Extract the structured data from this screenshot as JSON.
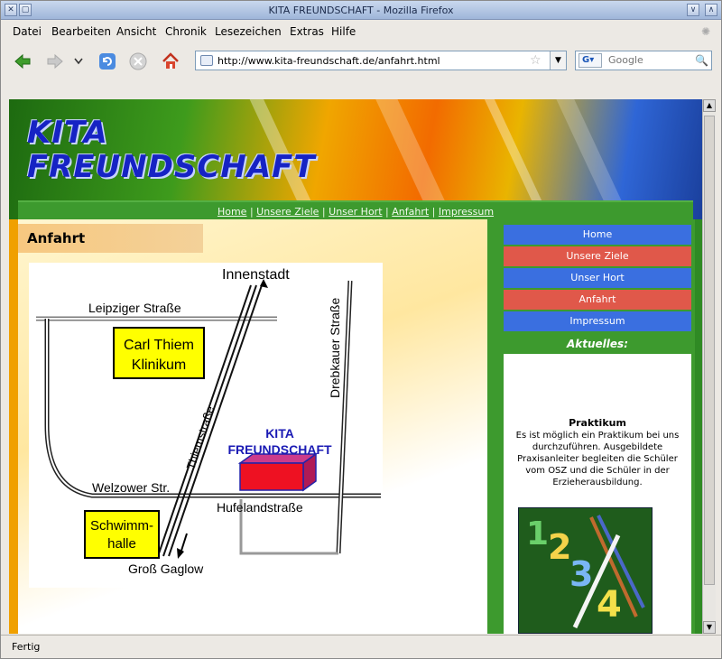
{
  "window": {
    "title": "KITA FREUNDSCHAFT - Mozilla Firefox"
  },
  "menubar": {
    "items": [
      "Datei",
      "Bearbeiten",
      "Ansicht",
      "Chronik",
      "Lesezeichen",
      "Extras",
      "Hilfe"
    ]
  },
  "toolbar": {
    "url": "http://www.kita-freundschaft.de/anfahrt.html",
    "search_placeholder": "Google"
  },
  "status": {
    "text": "Fertig"
  },
  "page": {
    "logo_line1": "KITA",
    "logo_line2": "FREUNDSCHAFT",
    "topnav": [
      "Home",
      "Unsere Ziele",
      "Unser Hort",
      "Anfahrt",
      "Impressum"
    ],
    "topnav_separator": "|",
    "heading": "Anfahrt",
    "sidebar_menu": [
      {
        "label": "Home",
        "color": "#3a6fe0"
      },
      {
        "label": "Unsere Ziele",
        "color": "#e0584a"
      },
      {
        "label": "Unser Hort",
        "color": "#3a6fe0"
      },
      {
        "label": "Anfahrt",
        "color": "#e0584a"
      },
      {
        "label": "Impressum",
        "color": "#3a6fe0"
      }
    ],
    "news_heading": "Aktuelles:",
    "news_title": "Praktikum",
    "news_text": "Es ist möglich ein Praktikum bei uns durchzuführen. Ausgebildete Praxisanleiter begleiten die Schüler vom OSZ und die Schüler in der Erzieherausbildung.",
    "map": {
      "innenstadt": "Innenstadt",
      "leipziger": "Leipziger Straße",
      "drebkauer": "Drebkauer Straße",
      "carl_line1": "Carl Thiem",
      "carl_line2": "Klinikum",
      "thiemstrasse": "Thiemstraße",
      "kita_line1": "KITA",
      "kita_line2": "FREUNDSCHAFT",
      "welzower": "Welzower Str.",
      "hufeland": "Hufelandstraße",
      "schwimm_line1": "Schwimm-",
      "schwimm_line2": "halle",
      "gross_gaglow": "Groß Gaglow"
    }
  }
}
